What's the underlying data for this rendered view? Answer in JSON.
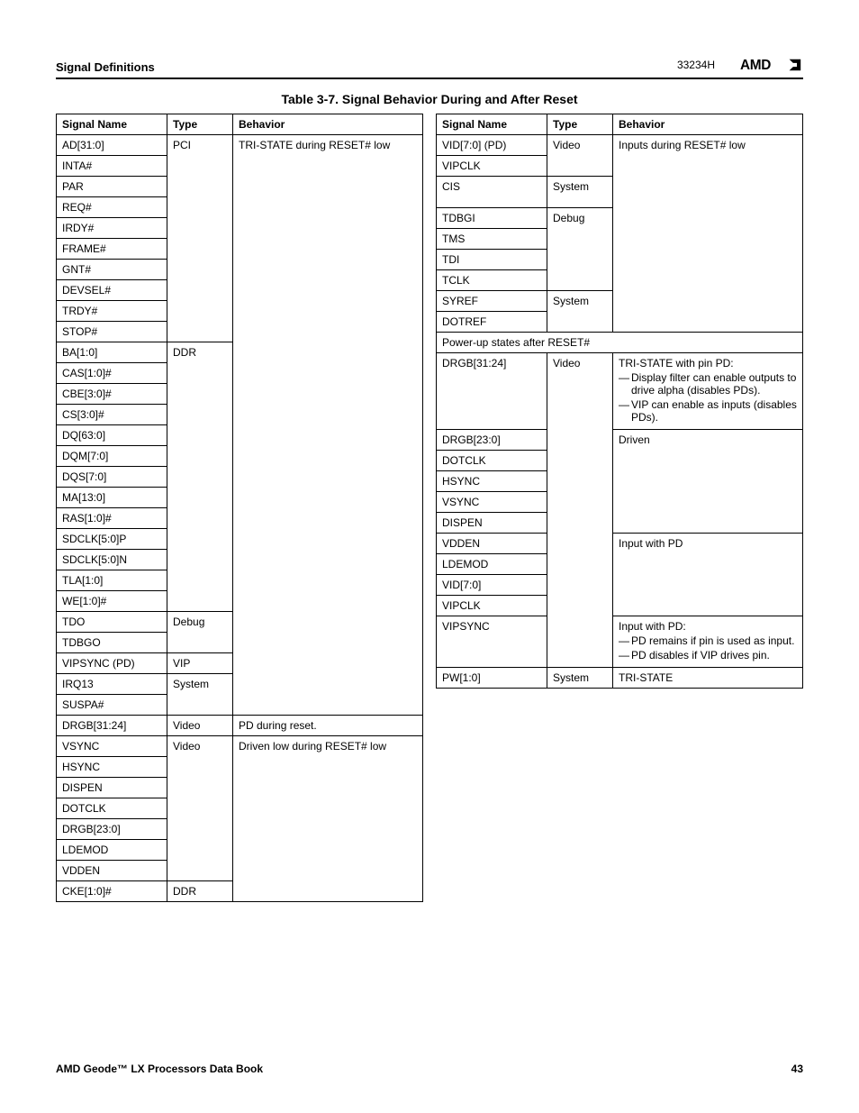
{
  "header": {
    "section": "Signal Definitions",
    "code": "33234H",
    "logo_text": "AMD"
  },
  "table_title": "Table 3-7.  Signal Behavior During and After Reset",
  "columns": [
    "Signal Name",
    "Type",
    "Behavior"
  ],
  "left_groups": [
    {
      "type": "PCI",
      "behavior": "TRI-STATE during RESET# low",
      "behavior_continues": true,
      "signals": [
        "AD[31:0]",
        "INTA#",
        "PAR",
        "REQ#",
        "IRDY#",
        "FRAME#",
        "GNT#",
        "DEVSEL#",
        "TRDY#",
        "STOP#"
      ]
    },
    {
      "type": "DDR",
      "behavior": null,
      "behavior_continues": true,
      "signals": [
        "BA[1:0]",
        "CAS[1:0]#",
        "CBE[3:0]#",
        "CS[3:0]#",
        "DQ[63:0]",
        "DQM[7:0]",
        "DQS[7:0]",
        "MA[13:0]",
        "RAS[1:0]#",
        "SDCLK[5:0]P",
        "SDCLK[5:0]N",
        "TLA[1:0]",
        "WE[1:0]#"
      ]
    },
    {
      "type": "Debug",
      "behavior": null,
      "behavior_continues": true,
      "signals": [
        "TDO",
        "TDBGO"
      ]
    },
    {
      "type": "VIP",
      "behavior": null,
      "behavior_continues": true,
      "signals": [
        "VIPSYNC (PD)"
      ]
    },
    {
      "type": "System",
      "behavior": null,
      "behavior_continues": true,
      "signals": [
        "IRQ13",
        "SUSPA#"
      ]
    },
    {
      "type": "Video",
      "behavior": "PD during reset.",
      "behavior_continues": false,
      "signals": [
        "DRGB[31:24]"
      ]
    },
    {
      "type": "Video",
      "behavior": "Driven low during RESET# low",
      "behavior_continues": false,
      "signals": [
        "VSYNC",
        "HSYNC",
        "DISPEN",
        "DOTCLK",
        "DRGB[23:0]",
        "LDEMOD",
        "VDDEN"
      ]
    },
    {
      "type": "DDR",
      "behavior": null,
      "behavior_continues": true,
      "signals": [
        "CKE[1:0]#"
      ]
    }
  ],
  "right_groups": [
    {
      "type": "Video",
      "behavior": "Inputs during RESET# low",
      "behavior_continues": true,
      "signals": [
        "VID[7:0] (PD)",
        "VIPCLK"
      ]
    },
    {
      "type": "System",
      "behavior": null,
      "behavior_continues": true,
      "signals": [
        "CIS"
      ],
      "tall_first": true
    },
    {
      "type": "Debug",
      "behavior": null,
      "behavior_continues": true,
      "signals": [
        "TDBGI",
        "TMS",
        "TDI",
        "TCLK"
      ]
    },
    {
      "type": "System",
      "behavior": null,
      "behavior_continues": true,
      "signals": [
        "SYREF",
        "DOTREF"
      ]
    }
  ],
  "right_spanner": "Power-up states after RESET#",
  "right_groups2": [
    {
      "type": "Video",
      "behavior_html": "TRI-STATE with pin PD:",
      "bullets": [
        "Display filter can enable outputs to drive alpha (disables PDs).",
        "VIP can enable as inputs (disables PDs)."
      ],
      "behavior_continues": false,
      "signals": [
        "DRGB[31:24]"
      ]
    },
    {
      "type": "",
      "behavior": "Driven",
      "behavior_continues": false,
      "signals": [
        "DRGB[23:0]",
        "DOTCLK",
        "HSYNC",
        "VSYNC",
        "DISPEN"
      ]
    },
    {
      "type": "",
      "behavior": "Input with PD",
      "behavior_continues": false,
      "signals": [
        "VDDEN",
        "LDEMOD",
        "VID[7:0]",
        "VIPCLK"
      ]
    },
    {
      "type": "",
      "behavior_html": "Input with PD:",
      "bullets": [
        "PD remains if pin is used as input.",
        "PD disables if VIP drives pin."
      ],
      "behavior_continues": false,
      "signals": [
        "VIPSYNC"
      ]
    },
    {
      "type": "System",
      "behavior": "TRI-STATE",
      "behavior_continues": false,
      "signals": [
        "PW[1:0]"
      ]
    }
  ],
  "footer": {
    "left": "AMD Geode™ LX Processors Data Book",
    "right": "43"
  }
}
